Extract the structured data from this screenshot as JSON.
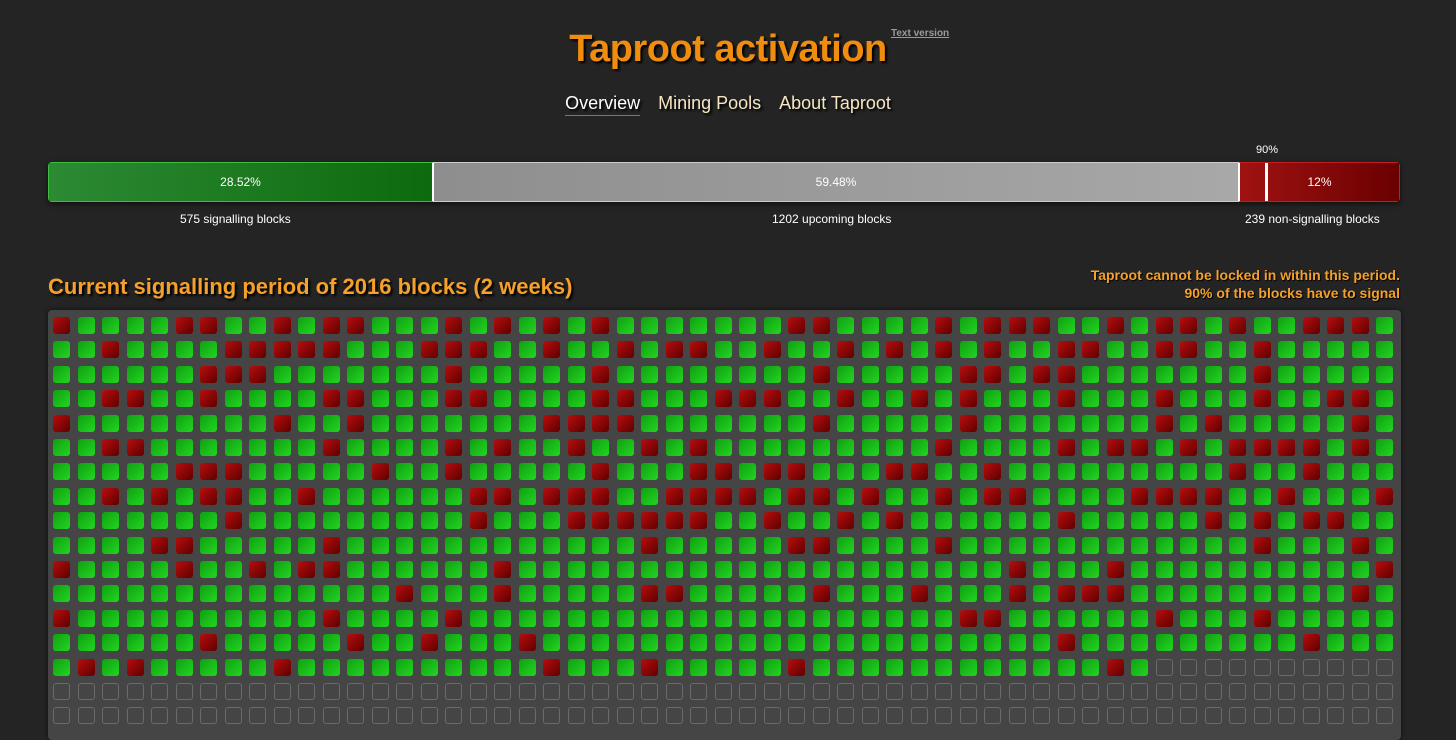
{
  "header": {
    "title": "Taproot activation",
    "text_version_link": "Text version"
  },
  "nav": {
    "items": [
      "Overview",
      "Mining Pools",
      "About Taproot"
    ],
    "active": "Overview"
  },
  "progress": {
    "threshold_label": "90%",
    "threshold_fraction": 0.9,
    "signalling": {
      "percent_label": "28.52%",
      "fraction": 0.2852,
      "caption": "575 signalling blocks"
    },
    "upcoming": {
      "percent_label": "59.48%",
      "fraction": 0.5948,
      "caption": "1202 upcoming blocks"
    },
    "non_signalling": {
      "percent_label": "12%",
      "fraction": 0.12,
      "caption": "239 non-signalling blocks"
    }
  },
  "period": {
    "title": "Current signalling period of 2016 blocks (2 weeks)",
    "note_line1": "Taproot cannot be locked in within this period.",
    "note_line2": "90% of the blocks have to signal"
  },
  "colors": {
    "accent": "#f08c0e",
    "signalling": "#1fc41f",
    "non_signalling": "#a00a0a",
    "upcoming": "#6a6a6a"
  },
  "blocks": {
    "columns": 55,
    "visible_rows": 17,
    "signalling_rows": [
      "RGGGGRRGGRGRRGGGRGRGRGRGGGGGGGRRGGGGRGRRRGGRGRRGRGGRRRG",
      "GGRGGGGRRRRRGGGRRRGGRGGRGRRGGRGGRGRGRGRGGRRGGRRGGRGGGGG",
      "GGGGGGRRRGGGGGGGRGGGGGRGGGGGGGGRGGGGGRRGRRGGGGGGGRGGGGG",
      "GGRRGGRGGGGRRGGGRRGGGGRRGGGRRRGGRGGRGRGGGRGGGRGGGRGGRRG",
      "RGGGGGGGGRGGRGGGGGGGRRRRGGGGGGGRGGGGGRGGGGGGGRGRGGGGGRG",
      "GGRRGGGGGGGRGGGGRGRGGRGGRGRGGGGGGGGGRGGGGRGRRGRGRRRRGRG",
      "GGGGGRRRGGGGGRGGRGGGGGRGGGRRGRRGGGRRGGRGGGGGGGGGRGGRGGG",
      "GGRGRGRRGGRGGGGGGRRGRRRGGRRRRGRRGRGGRGRRGGGGRRRRGGRGGGR",
      "GGGGGGGRGGGGGGGGGRGGGRRRRRRGGRGGRGRGGGGGGRGGGGGRGRGRRGG",
      "GGGGRRGGGGGRGGGGGGGGGGGGRGGGGGRRGGGGRGGGGGGGGGGGGRGGGRG",
      "RGGGGRGGRGRRGGGGGGRGGGGGGGGGGGGGGGGGGGGRGGGRGGGGGGGGGGR",
      "GGGGGGGGGGGGGGRGGGRGGGGGRRGGGGGRGGGRGGGRGRRRGGGGGGGGGRG",
      "RGGGGGGGGGGRGGGGRGGGGGGGGGGGGGGGGGGGGRRGGGGGGRGGGRGGGGG",
      "GGGGGGRGGGGGRGGRGGGRGGGGGGGGGGGGGGGGGGGGGRGGGGGGGGGRGGGGR",
      "GRGRGGGGGRGGGGGGGGGGRGGGRGGGGGRGGGGGGGGGGGGRG"
    ]
  }
}
